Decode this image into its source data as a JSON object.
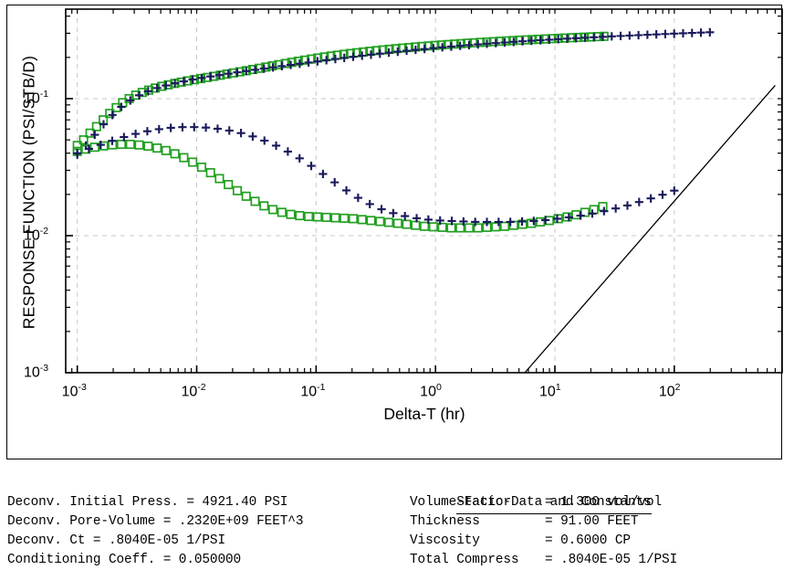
{
  "chart_data": {
    "type": "scatter",
    "title": "",
    "xlabel": "Delta-T (hr)",
    "ylabel": "RESPONSE FUNCTION (PSI/STB/D)",
    "xscale": "log",
    "yscale": "log",
    "xlim": [
      0.0008,
      800
    ],
    "ylim": [
      0.001,
      0.45
    ],
    "xticks": [
      "10-3",
      "10-2",
      "10-1",
      "100",
      "101",
      "102"
    ],
    "xtick_values": [
      0.001,
      0.01,
      0.1,
      1,
      10,
      100
    ],
    "yticks": [
      "10-3",
      "10-2",
      "10-1"
    ],
    "ytick_values": [
      0.001,
      0.01,
      0.1
    ],
    "grid": "dashed gray at decades",
    "legend": "none",
    "colors": {
      "squares": "#22a022",
      "plus": "#1a1a5c",
      "line": "#000000",
      "grid": "#c8c8c8"
    },
    "series": [
      {
        "name": "pressure-change-squares",
        "marker": "open-square",
        "color": "#22a022",
        "points": [
          [
            0.001,
            0.0455
          ],
          [
            0.00113,
            0.05
          ],
          [
            0.00128,
            0.056
          ],
          [
            0.00145,
            0.0625
          ],
          [
            0.00165,
            0.07
          ],
          [
            0.00187,
            0.078
          ],
          [
            0.00212,
            0.086
          ],
          [
            0.0024,
            0.0935
          ],
          [
            0.00272,
            0.1
          ],
          [
            0.00309,
            0.106
          ],
          [
            0.0035,
            0.111
          ],
          [
            0.00397,
            0.1155
          ],
          [
            0.0045,
            0.1195
          ],
          [
            0.0051,
            0.123
          ],
          [
            0.00578,
            0.1262
          ],
          [
            0.00655,
            0.1292
          ],
          [
            0.00743,
            0.132
          ],
          [
            0.00842,
            0.1348
          ],
          [
            0.00955,
            0.1375
          ],
          [
            0.01082,
            0.14
          ],
          [
            0.01227,
            0.1428
          ],
          [
            0.0139,
            0.1455
          ],
          [
            0.01576,
            0.1482
          ],
          [
            0.01786,
            0.151
          ],
          [
            0.02025,
            0.154
          ],
          [
            0.02295,
            0.157
          ],
          [
            0.02602,
            0.16
          ],
          [
            0.0295,
            0.1632
          ],
          [
            0.03343,
            0.1665
          ],
          [
            0.0379,
            0.17
          ],
          [
            0.04296,
            0.1735
          ],
          [
            0.0487,
            0.177
          ],
          [
            0.0552,
            0.1805
          ],
          [
            0.06258,
            0.184
          ],
          [
            0.07093,
            0.1875
          ],
          [
            0.08041,
            0.191
          ],
          [
            0.09115,
            0.1945
          ],
          [
            0.10333,
            0.198
          ],
          [
            0.11713,
            0.2013
          ],
          [
            0.13278,
            0.2045
          ],
          [
            0.15052,
            0.2075
          ],
          [
            0.17062,
            0.2105
          ],
          [
            0.19342,
            0.2135
          ],
          [
            0.21926,
            0.2163
          ],
          [
            0.24855,
            0.219
          ],
          [
            0.28176,
            0.2216
          ],
          [
            0.3194,
            0.2242
          ],
          [
            0.36207,
            0.2267
          ],
          [
            0.41044,
            0.2291
          ],
          [
            0.46528,
            0.2315
          ],
          [
            0.52744,
            0.2338
          ],
          [
            0.59789,
            0.236
          ],
          [
            0.67777,
            0.2382
          ],
          [
            0.76831,
            0.2403
          ],
          [
            0.87094,
            0.2424
          ],
          [
            0.98728,
            0.2444
          ],
          [
            1.11917,
            0.2464
          ],
          [
            1.26868,
            0.2483
          ],
          [
            1.43817,
            0.2502
          ],
          [
            1.63031,
            0.252
          ],
          [
            1.84812,
            0.2538
          ],
          [
            2.09503,
            0.2556
          ],
          [
            2.37491,
            0.2573
          ],
          [
            2.69216,
            0.259
          ],
          [
            3.05175,
            0.2606
          ],
          [
            3.45936,
            0.2622
          ],
          [
            3.92142,
            0.2638
          ],
          [
            4.4452,
            0.2654
          ],
          [
            5.039,
            0.2669
          ],
          [
            5.71217,
            0.2684
          ],
          [
            6.47535,
            0.2699
          ],
          [
            7.34058,
            0.2713
          ],
          [
            8.32152,
            0.2727
          ],
          [
            9.43367,
            0.2741
          ],
          [
            10.6946,
            0.2755
          ],
          [
            12.1241,
            0.2769
          ],
          [
            13.7446,
            0.2783
          ],
          [
            15.5817,
            0.2797
          ],
          [
            17.6645,
            0.281
          ],
          [
            20.0257,
            0.2823
          ],
          [
            22.703,
            0.2836
          ],
          [
            25.7378,
            0.2849
          ]
        ]
      },
      {
        "name": "pressure-change-plus",
        "marker": "plus",
        "color": "#1a1a5c",
        "points": [
          [
            0.001,
            0.039
          ],
          [
            0.00118,
            0.0455
          ],
          [
            0.0014,
            0.0545
          ],
          [
            0.00166,
            0.065
          ],
          [
            0.00197,
            0.076
          ],
          [
            0.00234,
            0.087
          ],
          [
            0.00278,
            0.097
          ],
          [
            0.0033,
            0.1058
          ],
          [
            0.00392,
            0.1132
          ],
          [
            0.00466,
            0.1195
          ],
          [
            0.00553,
            0.1248
          ],
          [
            0.00657,
            0.1295
          ],
          [
            0.0078,
            0.1338
          ],
          [
            0.00926,
            0.1378
          ],
          [
            0.011,
            0.1416
          ],
          [
            0.01306,
            0.1452
          ],
          [
            0.01551,
            0.1487
          ],
          [
            0.01842,
            0.1521
          ],
          [
            0.02188,
            0.1555
          ],
          [
            0.02598,
            0.1589
          ],
          [
            0.03085,
            0.1623
          ],
          [
            0.03664,
            0.1657
          ],
          [
            0.04351,
            0.1692
          ],
          [
            0.05167,
            0.1727
          ],
          [
            0.06136,
            0.1763
          ],
          [
            0.07287,
            0.1799
          ],
          [
            0.08654,
            0.1835
          ],
          [
            0.10277,
            0.1872
          ],
          [
            0.12205,
            0.1909
          ],
          [
            0.14494,
            0.1946
          ],
          [
            0.17213,
            0.1983
          ],
          [
            0.20442,
            0.202
          ],
          [
            0.24276,
            0.2057
          ],
          [
            0.2883,
            0.2094
          ],
          [
            0.34238,
            0.213
          ],
          [
            0.40661,
            0.2166
          ],
          [
            0.48287,
            0.2201
          ],
          [
            0.57344,
            0.2236
          ],
          [
            0.68101,
            0.227
          ],
          [
            0.80877,
            0.2303
          ],
          [
            0.96049,
            0.2336
          ],
          [
            1.14066,
            0.2368
          ],
          [
            1.35466,
            0.2399
          ],
          [
            1.60879,
            0.2429
          ],
          [
            1.91059,
            0.2459
          ],
          [
            2.26903,
            0.2488
          ],
          [
            2.69471,
            0.2516
          ],
          [
            3.20023,
            0.2543
          ],
          [
            3.80057,
            0.257
          ],
          [
            4.51352,
            0.2596
          ],
          [
            5.36027,
            0.2621
          ],
          [
            6.36597,
            0.2646
          ],
          [
            7.56047,
            0.267
          ],
          [
            8.97917,
            0.2694
          ],
          [
            10.664,
            0.2717
          ],
          [
            12.665,
            0.274
          ],
          [
            15.0415,
            0.2762
          ],
          [
            17.8635,
            0.2784
          ],
          [
            21.2155,
            0.2805
          ],
          [
            25.198,
            0.2826
          ],
          [
            29.928,
            0.2847
          ],
          [
            35.545,
            0.2867
          ],
          [
            42.215,
            0.2887
          ],
          [
            50.138,
            0.2906
          ],
          [
            59.546,
            0.2925
          ],
          [
            70.719,
            0.2944
          ],
          [
            83.99,
            0.2962
          ],
          [
            99.75,
            0.298
          ],
          [
            118.47,
            0.2998
          ],
          [
            140.71,
            0.3015
          ],
          [
            167.12,
            0.3032
          ],
          [
            198.49,
            0.3049
          ]
        ]
      },
      {
        "name": "derivative-squares",
        "marker": "open-square",
        "color": "#22a022",
        "points": [
          [
            0.001,
            0.0412
          ],
          [
            0.00118,
            0.0428
          ],
          [
            0.0014,
            0.0442
          ],
          [
            0.00166,
            0.0452
          ],
          [
            0.00197,
            0.046
          ],
          [
            0.00234,
            0.0464
          ],
          [
            0.00278,
            0.0464
          ],
          [
            0.0033,
            0.0459
          ],
          [
            0.00392,
            0.045
          ],
          [
            0.00466,
            0.0436
          ],
          [
            0.00553,
            0.0418
          ],
          [
            0.00657,
            0.0396
          ],
          [
            0.0078,
            0.0371
          ],
          [
            0.00926,
            0.0344
          ],
          [
            0.011,
            0.0316
          ],
          [
            0.01306,
            0.0288
          ],
          [
            0.01551,
            0.0261
          ],
          [
            0.01842,
            0.0236
          ],
          [
            0.02188,
            0.0213
          ],
          [
            0.02598,
            0.0194
          ],
          [
            0.03085,
            0.0178
          ],
          [
            0.03664,
            0.0165
          ],
          [
            0.04351,
            0.0155
          ],
          [
            0.05167,
            0.0148
          ],
          [
            0.06136,
            0.0143
          ],
          [
            0.07287,
            0.014
          ],
          [
            0.08654,
            0.0138
          ],
          [
            0.10277,
            0.0137
          ],
          [
            0.12205,
            0.0136
          ],
          [
            0.14494,
            0.0135
          ],
          [
            0.17213,
            0.0134
          ],
          [
            0.20442,
            0.0133
          ],
          [
            0.24276,
            0.0131
          ],
          [
            0.2883,
            0.0129
          ],
          [
            0.34238,
            0.0127
          ],
          [
            0.40661,
            0.0125
          ],
          [
            0.48287,
            0.0123
          ],
          [
            0.57344,
            0.0121
          ],
          [
            0.68101,
            0.0119
          ],
          [
            0.80877,
            0.0117
          ],
          [
            0.96049,
            0.0116
          ],
          [
            1.14066,
            0.0115
          ],
          [
            1.35466,
            0.0114
          ],
          [
            1.60879,
            0.0114
          ],
          [
            1.91059,
            0.0114
          ],
          [
            2.26903,
            0.0114
          ],
          [
            2.69471,
            0.0115
          ],
          [
            3.20023,
            0.0116
          ],
          [
            3.80057,
            0.0117
          ],
          [
            4.51352,
            0.0119
          ],
          [
            5.36027,
            0.0121
          ],
          [
            6.36597,
            0.0123
          ],
          [
            7.56047,
            0.0126
          ],
          [
            8.97917,
            0.0129
          ],
          [
            10.664,
            0.0133
          ],
          [
            12.665,
            0.0137
          ],
          [
            15.0415,
            0.0142
          ],
          [
            17.8635,
            0.0148
          ],
          [
            21.2155,
            0.0155
          ],
          [
            25.198,
            0.0163
          ]
        ]
      },
      {
        "name": "derivative-plus",
        "marker": "plus",
        "color": "#1a1a5c",
        "points": [
          [
            0.001,
            0.04
          ],
          [
            0.00125,
            0.043
          ],
          [
            0.00157,
            0.046
          ],
          [
            0.00196,
            0.0492
          ],
          [
            0.00246,
            0.0524
          ],
          [
            0.00308,
            0.0553
          ],
          [
            0.00386,
            0.0578
          ],
          [
            0.00484,
            0.0598
          ],
          [
            0.00607,
            0.0612
          ],
          [
            0.0076,
            0.0619
          ],
          [
            0.00953,
            0.062
          ],
          [
            0.01194,
            0.0615
          ],
          [
            0.01497,
            0.0603
          ],
          [
            0.01876,
            0.0585
          ],
          [
            0.02351,
            0.0561
          ],
          [
            0.02947,
            0.053
          ],
          [
            0.03693,
            0.0494
          ],
          [
            0.04628,
            0.0454
          ],
          [
            0.058,
            0.0411
          ],
          [
            0.0727,
            0.0367
          ],
          [
            0.0911,
            0.0323
          ],
          [
            0.1142,
            0.0282
          ],
          [
            0.1431,
            0.0245
          ],
          [
            0.1794,
            0.0214
          ],
          [
            0.2248,
            0.0189
          ],
          [
            0.2818,
            0.017
          ],
          [
            0.3532,
            0.0156
          ],
          [
            0.4427,
            0.0146
          ],
          [
            0.5548,
            0.0139
          ],
          [
            0.6954,
            0.0134
          ],
          [
            0.8716,
            0.0131
          ],
          [
            1.0924,
            0.0129
          ],
          [
            1.3692,
            0.0128
          ],
          [
            1.7161,
            0.0127
          ],
          [
            2.1509,
            0.0126
          ],
          [
            2.6958,
            0.0126
          ],
          [
            3.3787,
            0.0126
          ],
          [
            4.2347,
            0.0126
          ],
          [
            5.3074,
            0.0127
          ],
          [
            6.652,
            0.0128
          ],
          [
            8.3372,
            0.013
          ],
          [
            10.449,
            0.0133
          ],
          [
            13.096,
            0.0136
          ],
          [
            16.414,
            0.014
          ],
          [
            20.573,
            0.0145
          ],
          [
            25.783,
            0.0151
          ],
          [
            32.312,
            0.0158
          ],
          [
            40.495,
            0.0166
          ],
          [
            50.751,
            0.0176
          ],
          [
            63.605,
            0.0187
          ],
          [
            79.715,
            0.0199
          ],
          [
            99.9,
            0.0213
          ]
        ]
      }
    ],
    "reference_line": {
      "name": "unit-slope-line",
      "slope": 1,
      "color": "#000000",
      "x_start": 5.6,
      "y_start": 0.001,
      "x_end": 700,
      "y_end": 0.125
    }
  },
  "axis": {
    "xlabel": "Delta-T (hr)",
    "ylabel": "RESPONSE FUNCTION (PSI/STB/D)",
    "xticks": [
      {
        "base": "10",
        "exp": "-3"
      },
      {
        "base": "10",
        "exp": "-2"
      },
      {
        "base": "10",
        "exp": "-1"
      },
      {
        "base": "10",
        "exp": "0"
      },
      {
        "base": "10",
        "exp": "1"
      },
      {
        "base": "10",
        "exp": "2"
      }
    ],
    "yticks": [
      {
        "base": "10",
        "exp": "-1"
      },
      {
        "base": "10",
        "exp": "-2"
      },
      {
        "base": "10",
        "exp": "-3"
      }
    ]
  },
  "footer": {
    "left_rows": [
      "Deconv. Initial Press. = 4921.40 PSI",
      "Deconv. Pore-Volume = .2320E+09 FEET^3",
      "Deconv. Ct = .8040E-05 1/PSI",
      "Conditioning Coeff. = 0.050000"
    ],
    "right_header": "Static-Data and Constants",
    "right_rows": [
      {
        "key": "Volume-Factor",
        "value": "= 1.300 vol/vol"
      },
      {
        "key": "Thickness",
        "value": "= 91.00 FEET"
      },
      {
        "key": "Viscosity",
        "value": "= 0.6000 CP"
      },
      {
        "key": "Total Compress",
        "value": "= .8040E-05 1/PSI"
      }
    ]
  }
}
